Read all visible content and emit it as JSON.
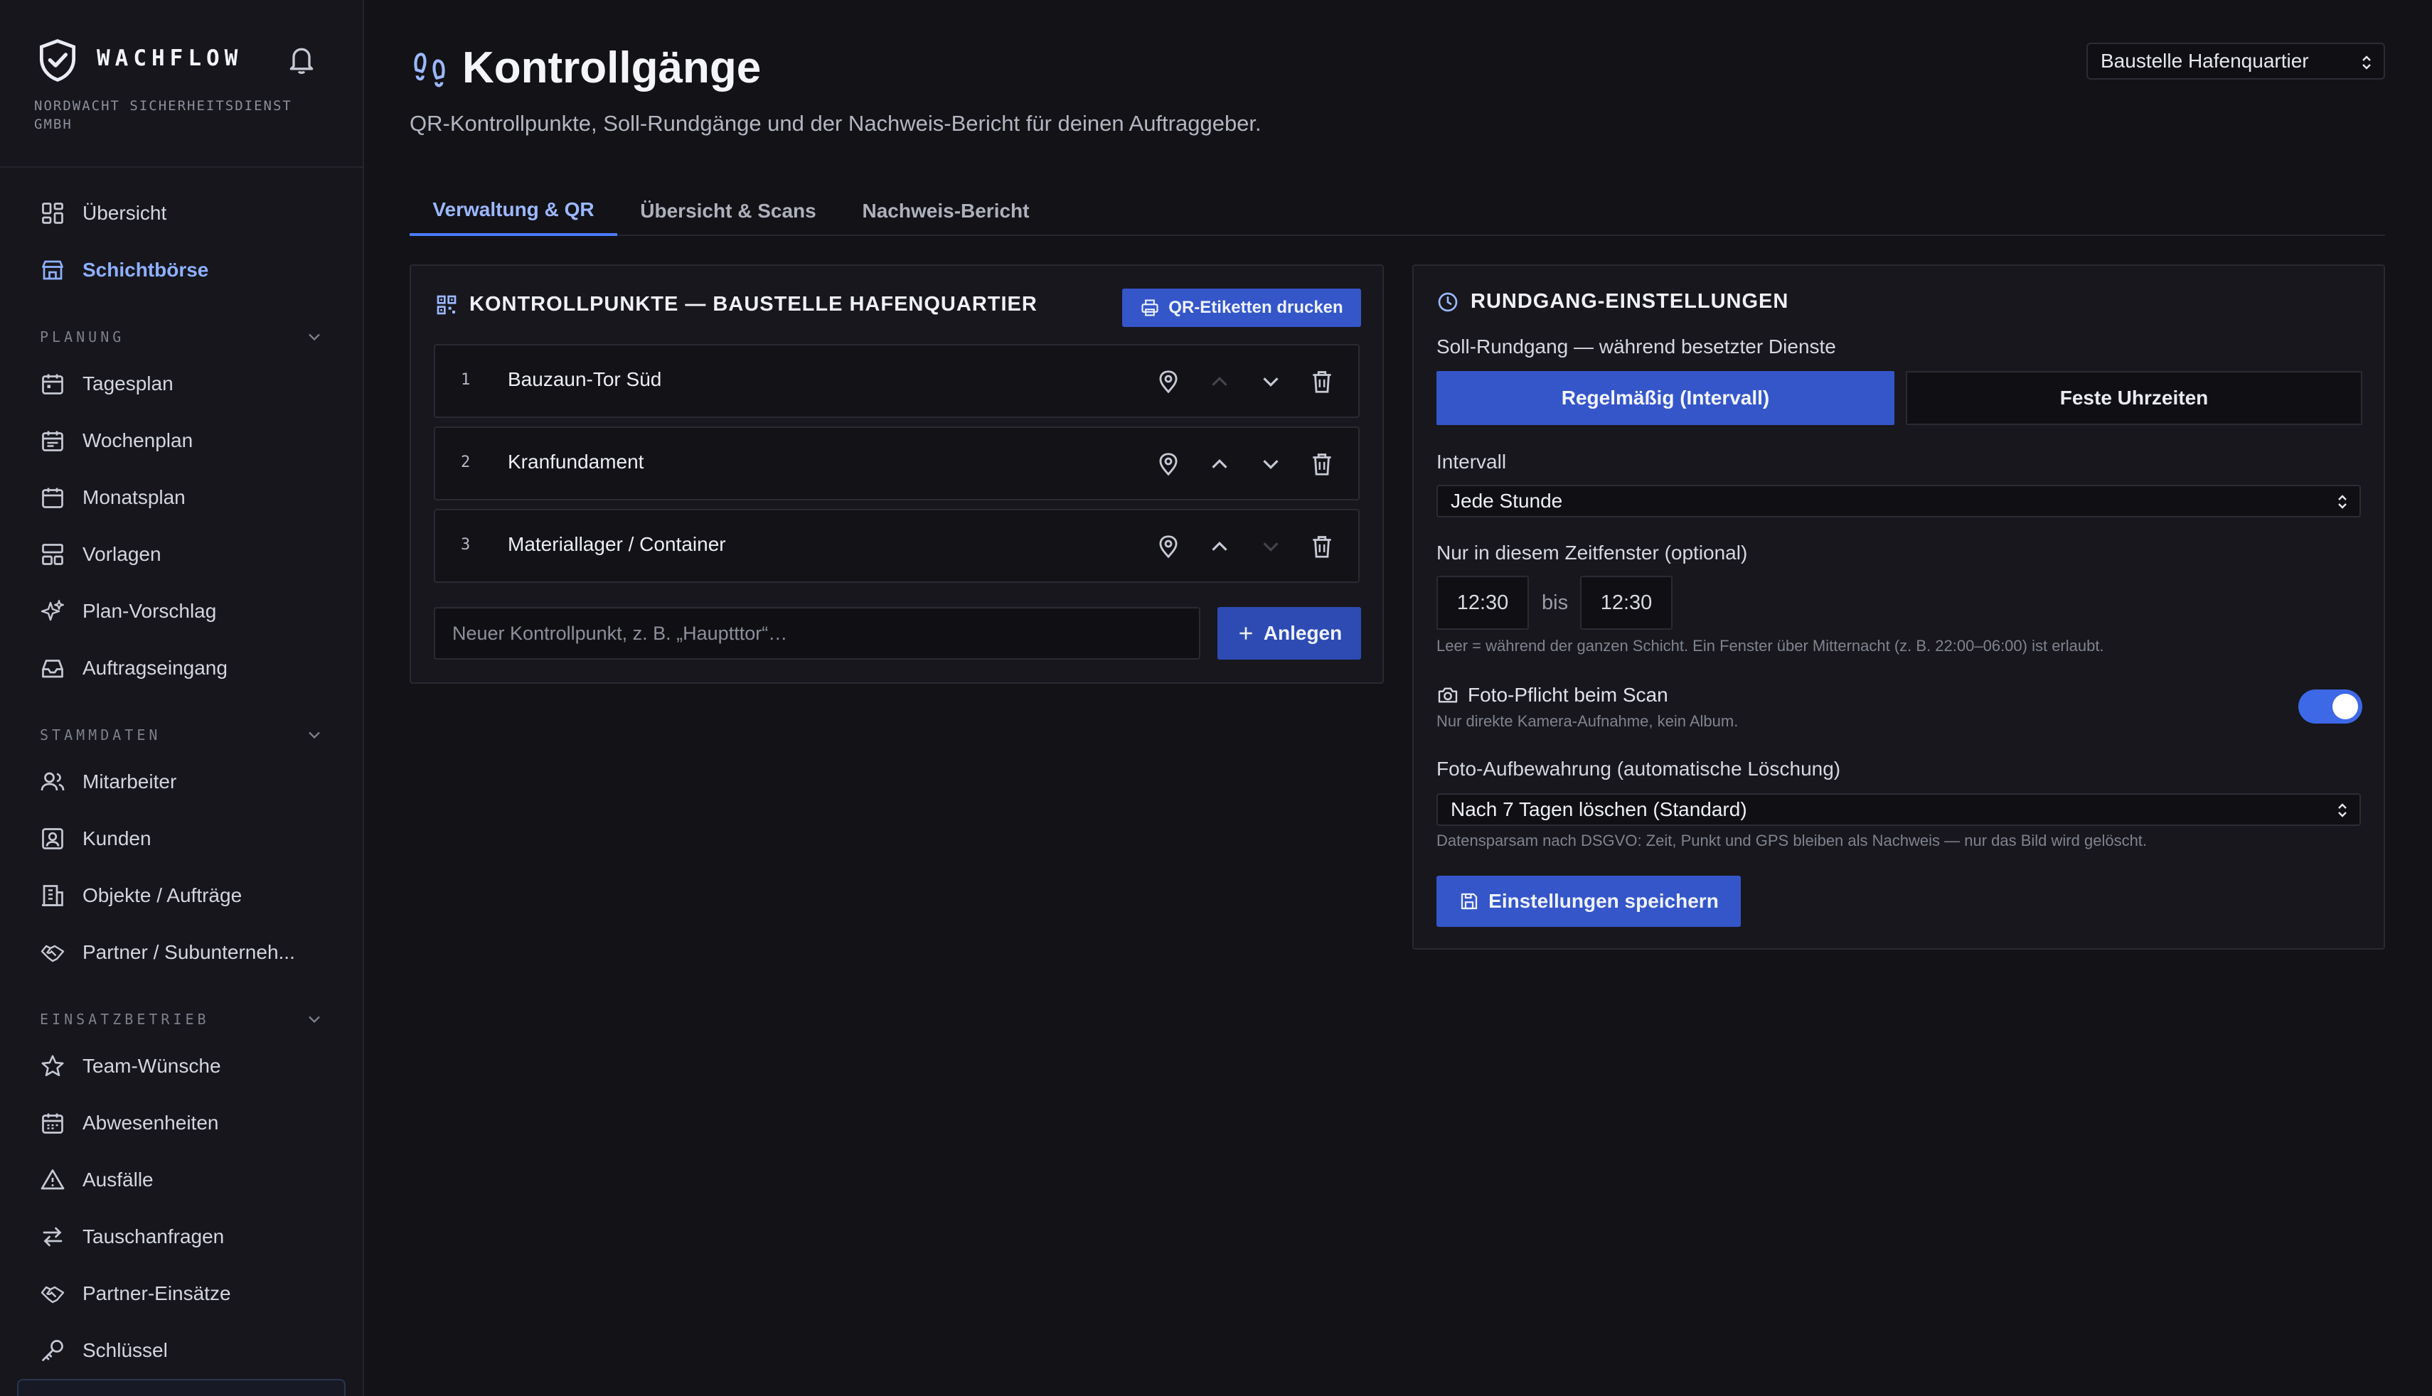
{
  "app": {
    "brand": "WACHFLOW",
    "org": "NORDWACHT SICHERHEITSDIENST GMBH"
  },
  "sidebar": {
    "top_items": [
      {
        "label": "Übersicht",
        "icon": "dashboard-icon"
      },
      {
        "label": "Schichtbörse",
        "icon": "store-icon",
        "active": true
      }
    ],
    "sections": [
      {
        "title": "PLANUNG",
        "items": [
          {
            "label": "Tagesplan",
            "icon": "calendar-day-icon"
          },
          {
            "label": "Wochenplan",
            "icon": "calendar-week-icon"
          },
          {
            "label": "Monatsplan",
            "icon": "calendar-month-icon"
          },
          {
            "label": "Vorlagen",
            "icon": "templates-icon"
          },
          {
            "label": "Plan-Vorschlag",
            "icon": "sparkles-icon"
          },
          {
            "label": "Auftragseingang",
            "icon": "inbox-icon"
          }
        ]
      },
      {
        "title": "STAMMDATEN",
        "items": [
          {
            "label": "Mitarbeiter",
            "icon": "users-icon"
          },
          {
            "label": "Kunden",
            "icon": "contact-icon"
          },
          {
            "label": "Objekte / Aufträge",
            "icon": "building-icon"
          },
          {
            "label": "Partner / Subunterneh...",
            "icon": "handshake-icon"
          }
        ]
      },
      {
        "title": "EINSATZBETRIEB",
        "items": [
          {
            "label": "Team-Wünsche",
            "icon": "star-icon"
          },
          {
            "label": "Abwesenheiten",
            "icon": "calendar-absence-icon"
          },
          {
            "label": "Ausfälle",
            "icon": "warning-icon"
          },
          {
            "label": "Tauschanfragen",
            "icon": "swap-icon"
          },
          {
            "label": "Partner-Einsätze",
            "icon": "handshake-icon"
          },
          {
            "label": "Schlüssel",
            "icon": "key-icon"
          }
        ]
      }
    ]
  },
  "header": {
    "title": "Kontrollgänge",
    "subtitle": "QR-Kontrollpunkte, Soll-Rundgänge und der Nachweis-Bericht für deinen Auftraggeber.",
    "site_select": "Baustelle Hafenquartier"
  },
  "tabs": [
    {
      "label": "Verwaltung & QR",
      "active": true
    },
    {
      "label": "Übersicht & Scans"
    },
    {
      "label": "Nachweis-Bericht"
    }
  ],
  "checkpoints_panel": {
    "title": "KONTROLLPUNKTE — BAUSTELLE HAFENQUARTIER",
    "print_button": "QR-Etiketten drucken",
    "items": [
      {
        "num": "1",
        "name": "Bauzaun-Tor Süd"
      },
      {
        "num": "2",
        "name": "Kranfundament"
      },
      {
        "num": "3",
        "name": "Materiallager / Container"
      }
    ],
    "new_placeholder": "Neuer Kontrollpunkt, z. B. „Hauptttor“…",
    "add_button": "Anlegen"
  },
  "settings_panel": {
    "title": "RUNDGANG-EINSTELLUNGEN",
    "mode_label": "Soll-Rundgang — während besetzter Dienste",
    "mode_options": [
      "Regelmäßig (Intervall)",
      "Feste Uhrzeiten"
    ],
    "interval_label": "Intervall",
    "interval_value": "Jede Stunde",
    "window_label": "Nur in diesem Zeitfenster (optional)",
    "window_from": "12:30",
    "window_sep": "bis",
    "window_to": "12:30",
    "window_hint": "Leer = während der ganzen Schicht. Ein Fenster über Mitternacht (z. B. 22:00–06:00) ist erlaubt.",
    "photo_label": "Foto-Pflicht beim Scan",
    "photo_hint": "Nur direkte Kamera-Aufnahme, kein Album.",
    "photo_enabled": true,
    "retention_label": "Foto-Aufbewahrung (automatische Löschung)",
    "retention_value": "Nach 7 Tagen löschen (Standard)",
    "retention_hint": "Datensparsam nach DSGVO: Zeit, Punkt und GPS bleiben als Nachweis — nur das Bild wird gelöscht.",
    "save_button": "Einstellungen speichern"
  },
  "colors": {
    "accent": "#3556c9",
    "active_text": "#8fb0ff",
    "background": "#121217"
  }
}
